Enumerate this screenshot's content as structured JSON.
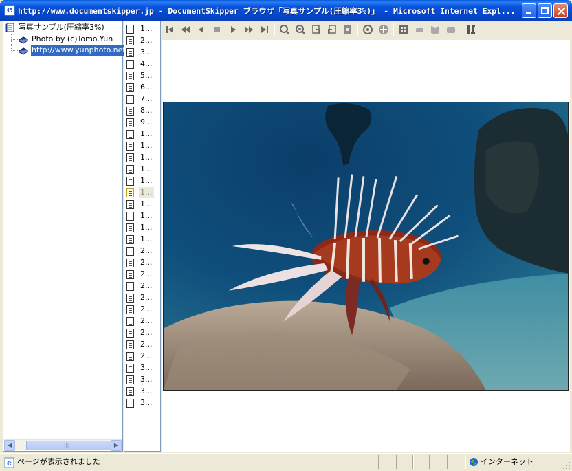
{
  "window": {
    "title": "http://www.documentskipper.jp - DocumentSkipper ブラウザ「写真サンプル(圧縮率3%)」 - Microsoft Internet Expl...",
    "app_icon": "ie-document-icon"
  },
  "tree": {
    "root_label": "写真サンプル(圧縮率3%)",
    "items": [
      {
        "label": "Photo by (c)Tomo.Yun",
        "icon": "book-icon",
        "selected": false
      },
      {
        "label": "http://www.yunphoto.net",
        "icon": "book-icon",
        "selected": true
      }
    ]
  },
  "pages": {
    "labels": [
      "1...",
      "2...",
      "3...",
      "4...",
      "5...",
      "6...",
      "7...",
      "8...",
      "9...",
      "1...",
      "1...",
      "1...",
      "1...",
      "1...",
      "1...",
      "1...",
      "1...",
      "1...",
      "1...",
      "2...",
      "2...",
      "2...",
      "2...",
      "2...",
      "2...",
      "2...",
      "2...",
      "2...",
      "2...",
      "3...",
      "3...",
      "3...",
      "3..."
    ],
    "current_index": 14
  },
  "toolbar": {
    "buttons": [
      "first-page-icon",
      "prev-chapter-icon",
      "prev-page-icon",
      "stop-icon",
      "next-page-icon",
      "next-chapter-icon",
      "last-page-icon",
      "zoom-out-icon",
      "zoom-in-icon",
      "rotate-left-icon",
      "rotate-right-icon",
      "fit-icon",
      "search-icon",
      "add-icon",
      "thumbnail-icon",
      "hand-icon",
      "bookmark-icon",
      "print-icon",
      "settings-icon"
    ]
  },
  "viewer": {
    "photo_alt": "lionfish-photo"
  },
  "status": {
    "text": "ページが表示されました",
    "zone": "インターネット"
  },
  "colors": {
    "titlebar": "#0a55dd",
    "selection": "#316ac5",
    "chrome": "#ece9d8"
  }
}
